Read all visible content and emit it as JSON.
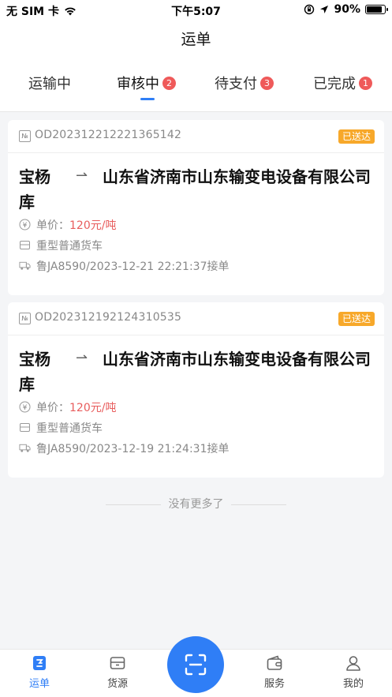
{
  "status_bar": {
    "carrier": "无 SIM 卡",
    "time": "下午5:07",
    "battery": "90%",
    "battery_level": 0.9
  },
  "nav": {
    "title": "运单"
  },
  "tabs": [
    {
      "label": "运输中",
      "badge": "",
      "active": false
    },
    {
      "label": "审核中",
      "badge": "2",
      "active": true
    },
    {
      "label": "待支付",
      "badge": "3",
      "active": false
    },
    {
      "label": "已完成",
      "badge": "1",
      "active": false
    }
  ],
  "orders": [
    {
      "order_no": "OD20231221222136 5142",
      "status": "已送达",
      "from": "宝杨库",
      "to": "山东省济南市山东输变电设备有限公司",
      "price_label": "单价：",
      "price_value": "120元/吨",
      "vehicle": "重型普通货车",
      "plate_time": "鲁JA8590/2023-12-21 22:21:37接单"
    },
    {
      "order_no": "OD20231219212431 0535",
      "status": "已送达",
      "from": "宝杨库",
      "to": "山东省济南市山东输变电设备有限公司",
      "price_label": "单价：",
      "price_value": "120元/吨",
      "vehicle": "重型普通货车",
      "plate_time": "鲁JA8590/2023-12-19 21:24:31接单"
    }
  ],
  "footer_note": "没有更多了",
  "bottom_nav": [
    {
      "label": "运单",
      "icon": "waybill-icon",
      "active": true
    },
    {
      "label": "货源",
      "icon": "cargo-icon",
      "active": false
    },
    {
      "label": "",
      "icon": "scan-icon",
      "active": false
    },
    {
      "label": "服务",
      "icon": "wallet-icon",
      "active": false
    },
    {
      "label": "我的",
      "icon": "profile-icon",
      "active": false
    }
  ],
  "colors": {
    "accent": "#2f7ef6",
    "badge": "#ef5a5a",
    "status_tag": "#f7a82a",
    "price": "#e85d5d"
  }
}
